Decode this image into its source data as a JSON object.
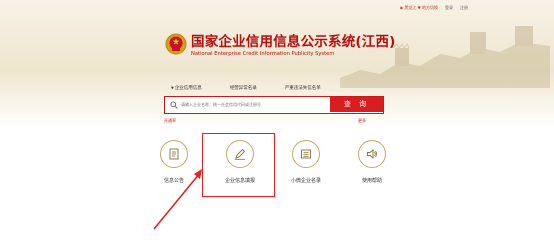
{
  "topbar": {
    "location": "◉ 黑龙江  ▼ 地方切换",
    "login": "登录",
    "register": "注册"
  },
  "header": {
    "title_cn": "国家企业信用信息公示系统(江西)",
    "title_en": "National Enterprise Credit Information Publicity System"
  },
  "search": {
    "tabs": [
      "企业信用信息",
      "经营异常名录",
      "严重违法失信名单"
    ],
    "placeholder": "请输入企业名称、统一社会信用代码或注册号",
    "button": "查 询",
    "under_left": "开通率",
    "under_right": "更多"
  },
  "services": [
    {
      "label": "信息公告",
      "icon": "notice-icon"
    },
    {
      "label": "企业信息填报",
      "icon": "pen-icon"
    },
    {
      "label": "小微企业名录",
      "icon": "list-icon"
    },
    {
      "label": "使用帮助",
      "icon": "speaker-icon"
    }
  ],
  "colors": {
    "brand": "#b30f0f",
    "button": "#d81e1e",
    "icon_ring": "#c9a46a",
    "highlight": "#e02424"
  }
}
